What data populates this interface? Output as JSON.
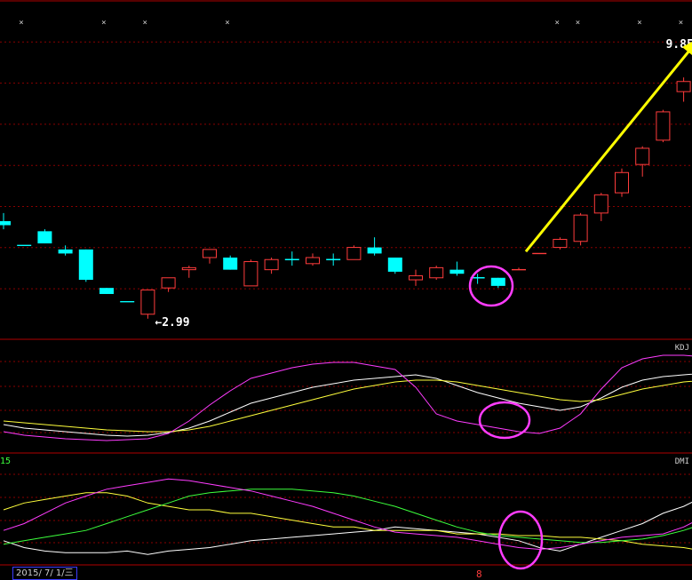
{
  "chart_data": [
    {
      "panel": "main",
      "type": "candlestick",
      "price_marks": {
        "high": "9.85",
        "low": "2.99"
      },
      "candles": [
        {
          "o": 5.4,
          "h": 5.6,
          "l": 5.2,
          "c": 5.3,
          "up": false
        },
        {
          "o": 4.8,
          "h": 4.8,
          "l": 4.8,
          "c": 4.8,
          "up": false
        },
        {
          "o": 5.15,
          "h": 5.2,
          "l": 4.85,
          "c": 4.85,
          "up": false
        },
        {
          "o": 4.7,
          "h": 4.8,
          "l": 4.55,
          "c": 4.6,
          "up": false
        },
        {
          "o": 4.7,
          "h": 4.7,
          "l": 3.9,
          "c": 3.95,
          "up": false
        },
        {
          "o": 3.75,
          "h": 3.75,
          "l": 3.6,
          "c": 3.6,
          "up": false
        },
        {
          "o": 3.41,
          "h": 3.41,
          "l": 3.41,
          "c": 3.41,
          "up": false
        },
        {
          "o": 3.1,
          "h": 3.7,
          "l": 2.99,
          "c": 3.7,
          "up": true
        },
        {
          "o": 3.75,
          "h": 4.0,
          "l": 3.65,
          "c": 4.0,
          "up": true
        },
        {
          "o": 4.2,
          "h": 4.3,
          "l": 4.0,
          "c": 4.25,
          "up": true
        },
        {
          "o": 4.5,
          "h": 4.7,
          "l": 4.35,
          "c": 4.7,
          "up": true
        },
        {
          "o": 4.5,
          "h": 4.55,
          "l": 4.2,
          "c": 4.2,
          "up": false
        },
        {
          "o": 3.8,
          "h": 4.45,
          "l": 3.8,
          "c": 4.4,
          "up": true
        },
        {
          "o": 4.2,
          "h": 4.5,
          "l": 4.1,
          "c": 4.45,
          "up": true
        },
        {
          "o": 4.45,
          "h": 4.65,
          "l": 4.3,
          "c": 4.45,
          "up": false
        },
        {
          "o": 4.35,
          "h": 4.6,
          "l": 4.3,
          "c": 4.5,
          "up": true
        },
        {
          "o": 4.45,
          "h": 4.6,
          "l": 4.3,
          "c": 4.45,
          "up": false
        },
        {
          "o": 4.45,
          "h": 4.8,
          "l": 4.45,
          "c": 4.75,
          "up": true
        },
        {
          "o": 4.75,
          "h": 5.0,
          "l": 4.55,
          "c": 4.6,
          "up": false
        },
        {
          "o": 4.5,
          "h": 4.5,
          "l": 4.1,
          "c": 4.15,
          "up": false
        },
        {
          "o": 3.95,
          "h": 4.2,
          "l": 3.8,
          "c": 4.05,
          "up": true
        },
        {
          "o": 4.0,
          "h": 4.3,
          "l": 3.95,
          "c": 4.25,
          "up": true
        },
        {
          "o": 4.2,
          "h": 4.4,
          "l": 4.05,
          "c": 4.1,
          "up": false
        },
        {
          "o": 4.0,
          "h": 4.1,
          "l": 3.85,
          "c": 4.0,
          "up": false
        },
        {
          "o": 4.0,
          "h": 4.0,
          "l": 3.75,
          "c": 3.8,
          "up": false
        },
        {
          "o": 4.2,
          "h": 4.25,
          "l": 4.2,
          "c": 4.2,
          "up": true
        },
        {
          "o": 4.6,
          "h": 4.6,
          "l": 4.6,
          "c": 4.6,
          "up": true
        },
        {
          "o": 4.75,
          "h": 5.0,
          "l": 4.7,
          "c": 4.95,
          "up": true
        },
        {
          "o": 4.9,
          "h": 5.6,
          "l": 4.8,
          "c": 5.55,
          "up": true
        },
        {
          "o": 5.6,
          "h": 6.1,
          "l": 5.4,
          "c": 6.05,
          "up": true
        },
        {
          "o": 6.1,
          "h": 6.7,
          "l": 6.0,
          "c": 6.6,
          "up": true
        },
        {
          "o": 6.8,
          "h": 7.25,
          "l": 6.5,
          "c": 7.2,
          "up": true
        },
        {
          "o": 7.4,
          "h": 8.15,
          "l": 7.35,
          "c": 8.1,
          "up": true
        },
        {
          "o": 8.6,
          "h": 8.95,
          "l": 8.35,
          "c": 8.85,
          "up": true
        },
        {
          "o": 9.3,
          "h": 9.85,
          "l": 9.0,
          "c": 9.8,
          "up": true
        }
      ],
      "ylim": [
        2.7,
        10.6
      ],
      "top_markers": [
        0,
        4,
        6,
        10,
        26,
        27,
        30,
        32
      ],
      "annotation_arrow": {
        "from_index": 25,
        "from_price": 4.65,
        "to_index": 34,
        "to_price": 9.95
      }
    },
    {
      "panel": "kdj",
      "type": "line",
      "label": "KDJ",
      "ylim": [
        -10,
        110
      ],
      "series": [
        {
          "color": "#ffffff",
          "values": [
            18,
            14,
            12,
            10,
            8,
            6,
            5,
            6,
            9,
            14,
            22,
            32,
            42,
            48,
            54,
            60,
            64,
            68,
            70,
            72,
            74,
            70,
            62,
            54,
            48,
            42,
            38,
            34,
            38,
            48,
            60,
            68,
            72,
            74,
            76,
            76
          ]
        },
        {
          "color": "#ffff3c",
          "values": [
            22,
            20,
            18,
            16,
            14,
            12,
            11,
            10,
            10,
            12,
            16,
            22,
            28,
            34,
            40,
            46,
            52,
            58,
            62,
            66,
            68,
            68,
            66,
            62,
            58,
            54,
            50,
            46,
            44,
            46,
            52,
            58,
            62,
            66,
            68,
            70
          ]
        },
        {
          "color": "#ff3cff",
          "values": [
            10,
            6,
            4,
            2,
            1,
            0,
            1,
            2,
            8,
            22,
            40,
            56,
            70,
            76,
            82,
            86,
            88,
            88,
            84,
            80,
            60,
            30,
            22,
            18,
            14,
            10,
            8,
            14,
            30,
            58,
            82,
            92,
            96,
            96,
            94,
            90
          ]
        }
      ]
    },
    {
      "panel": "dmi",
      "type": "line",
      "label": "DMI",
      "left_label": "15",
      "ylim": [
        0,
        60
      ],
      "series": [
        {
          "color": "#ffffff",
          "values": [
            12,
            8,
            6,
            5,
            5,
            5,
            6,
            4,
            6,
            7,
            8,
            10,
            12,
            13,
            14,
            15,
            16,
            17,
            18,
            20,
            19,
            18,
            17,
            16,
            14,
            12,
            8,
            6,
            10,
            14,
            18,
            22,
            28,
            32,
            38,
            44
          ]
        },
        {
          "color": "#ffff3c",
          "values": [
            30,
            34,
            36,
            38,
            40,
            40,
            38,
            34,
            32,
            30,
            30,
            28,
            28,
            26,
            24,
            22,
            20,
            20,
            18,
            18,
            18,
            18,
            16,
            16,
            16,
            15,
            15,
            14,
            14,
            13,
            12,
            10,
            9,
            8,
            6,
            5
          ]
        },
        {
          "color": "#3cff3c",
          "values": [
            10,
            12,
            14,
            16,
            18,
            22,
            26,
            30,
            34,
            38,
            40,
            41,
            42,
            42,
            42,
            41,
            40,
            38,
            35,
            32,
            28,
            24,
            20,
            17,
            15,
            14,
            13,
            12,
            11,
            11,
            12,
            13,
            15,
            18,
            22,
            26
          ]
        },
        {
          "color": "#ff3cff",
          "values": [
            18,
            22,
            28,
            34,
            38,
            42,
            44,
            46,
            48,
            47,
            45,
            43,
            41,
            38,
            35,
            32,
            28,
            24,
            20,
            17,
            16,
            15,
            14,
            12,
            10,
            8,
            7,
            8,
            10,
            12,
            14,
            15,
            16,
            20,
            26,
            34
          ]
        }
      ]
    },
    {
      "panel": "footer",
      "date_label": "2015/ 7/ 1/三",
      "bottom_number": "8"
    }
  ]
}
